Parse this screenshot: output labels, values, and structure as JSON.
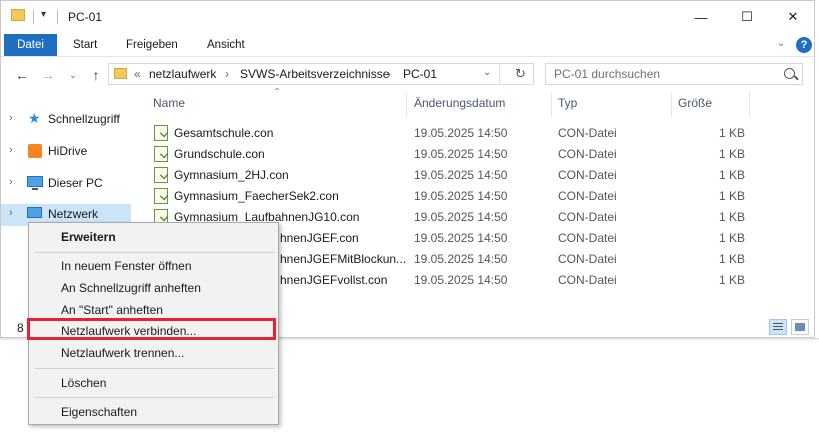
{
  "window": {
    "title": "PC-01",
    "controls": {
      "minimize": "—",
      "maximize": "☐",
      "close": "✕"
    }
  },
  "ribbon": {
    "tabs": [
      "Datei",
      "Start",
      "Freigeben",
      "Ansicht"
    ],
    "help": "?"
  },
  "address": {
    "overflow": "«",
    "crumbs": [
      "netzlaufwerk",
      "SVWS-Arbeitsverzeichnisse",
      "PC-01"
    ],
    "separator": "›"
  },
  "search": {
    "placeholder": "PC-01 durchsuchen"
  },
  "navpane": {
    "items": [
      {
        "label": "Schnellzugriff",
        "icon": "star-icon"
      },
      {
        "label": "HiDrive",
        "icon": "hidrive-icon"
      },
      {
        "label": "Dieser PC",
        "icon": "computer-icon"
      },
      {
        "label": "Netzwerk",
        "icon": "network-icon"
      }
    ]
  },
  "columns": [
    "Name",
    "Änderungsdatum",
    "Typ",
    "Größe"
  ],
  "files": [
    {
      "name": "Gesamtschule.con",
      "date": "19.05.2025 14:50",
      "type": "CON-Datei",
      "size": "1 KB"
    },
    {
      "name": "Grundschule.con",
      "date": "19.05.2025 14:50",
      "type": "CON-Datei",
      "size": "1 KB"
    },
    {
      "name": "Gymnasium_2HJ.con",
      "date": "19.05.2025 14:50",
      "type": "CON-Datei",
      "size": "1 KB"
    },
    {
      "name": "Gymnasium_FaecherSek2.con",
      "date": "19.05.2025 14:50",
      "type": "CON-Datei",
      "size": "1 KB"
    },
    {
      "name": "Gymnasium_LaufbahnenJG10.con",
      "date": "19.05.2025 14:50",
      "type": "CON-Datei",
      "size": "1 KB"
    },
    {
      "name": "hnenJGEF.con",
      "date": "19.05.2025 14:50",
      "type": "CON-Datei",
      "size": "1 KB"
    },
    {
      "name": "hnenJGEFMitBlockun...",
      "date": "19.05.2025 14:50",
      "type": "CON-Datei",
      "size": "1 KB"
    },
    {
      "name": "hnenJGEFvollst.con",
      "date": "19.05.2025 14:50",
      "type": "CON-Datei",
      "size": "1 KB"
    }
  ],
  "status": {
    "item_count": "8"
  },
  "context_menu": {
    "items": [
      "Erweitern",
      "In neuem Fenster öffnen",
      "An Schnellzugriff anheften",
      "An \"Start\" anheften",
      "Netzlaufwerk verbinden...",
      "Netzlaufwerk trennen...",
      "Löschen",
      "Eigenschaften"
    ],
    "highlighted": "Netzlaufwerk verbinden..."
  },
  "colors": {
    "accent": "#1f6fc0",
    "highlight_border": "#e8232f",
    "folder": "#f1c95b"
  }
}
